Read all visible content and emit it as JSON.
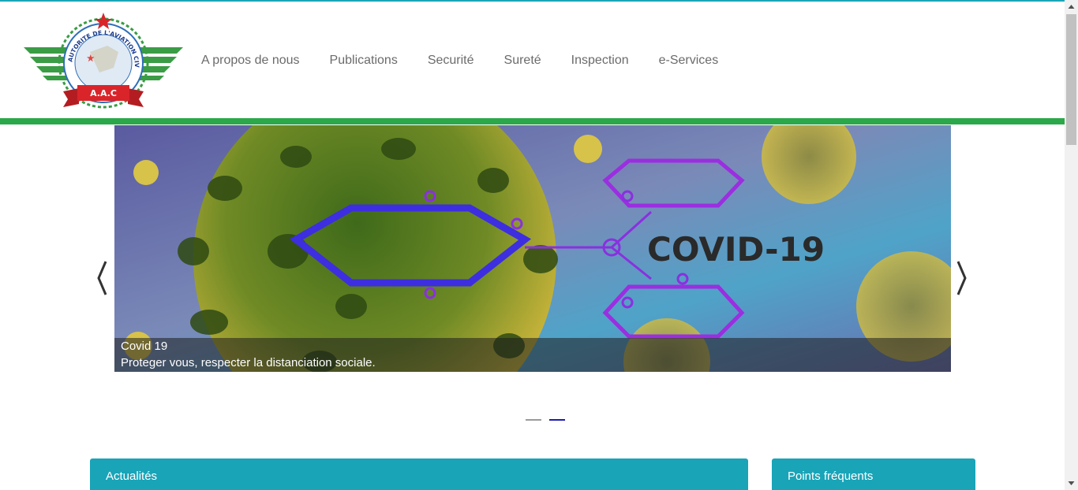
{
  "logo": {
    "arc_text": "AUTORITE DE L'AVIATION CIVILE",
    "ribbon_text": "A.A.C"
  },
  "nav": [
    {
      "label": "A propos de nous"
    },
    {
      "label": "Publications"
    },
    {
      "label": "Securité"
    },
    {
      "label": "Sureté"
    },
    {
      "label": "Inspection"
    },
    {
      "label": "e-Services"
    }
  ],
  "slider": {
    "image_text": "COVID-19",
    "caption_title": "Covid 19",
    "caption_text": "Proteger vous, respecter la distanciation sociale.",
    "dots": [
      {
        "active": false,
        "color": "#9a9a9a"
      },
      {
        "active": true,
        "color": "#1b1bb0"
      }
    ]
  },
  "panels": {
    "news_title": "Actualités",
    "faq_title": "Points fréquents"
  },
  "colors": {
    "accent": "#19a4b8",
    "green": "#2ba84a"
  }
}
